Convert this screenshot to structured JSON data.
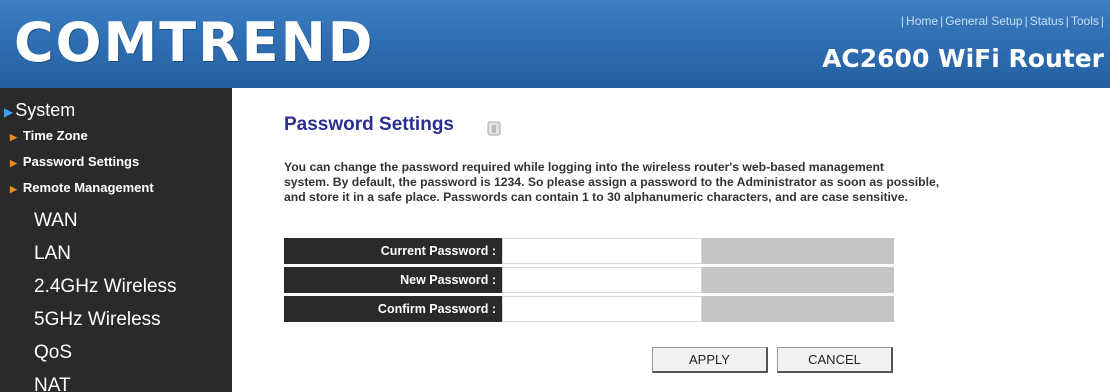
{
  "header": {
    "logo": "COMTREND",
    "product": "AC2600 WiFi Router",
    "links": [
      "Home",
      "General Setup",
      "Status",
      "Tools"
    ]
  },
  "sidebar": {
    "section": "System",
    "sub_items": [
      "Time Zone",
      "Password Settings",
      "Remote Management"
    ],
    "items": [
      "WAN",
      "LAN",
      "2.4GHz Wireless",
      "5GHz Wireless",
      "QoS",
      "NAT"
    ]
  },
  "main": {
    "title": "Password Settings",
    "description_lines": [
      "You can change the password required while logging into the wireless router's web-based management",
      "system. By default, the password is 1234. So please assign a password to the Administrator as soon as possible,",
      "and store it in a safe place. Passwords can contain 1 to 30 alphanumeric characters, and are case sensitive."
    ],
    "fields": [
      {
        "label": "Current Password :",
        "value": ""
      },
      {
        "label": "New Password :",
        "value": ""
      },
      {
        "label": "Confirm Password :",
        "value": ""
      }
    ],
    "apply_label": "APPLY",
    "cancel_label": "CANCEL"
  },
  "colors": {
    "header_blue": "#2f6fb4",
    "sidebar_bg": "#2a2a2a",
    "title_color": "#2b2f91",
    "system_arrow": "#3fa3ff",
    "sub_arrow": "#f08a1a"
  },
  "icons": {
    "help": "help-icon",
    "section_arrow": "triangle-right-icon"
  }
}
